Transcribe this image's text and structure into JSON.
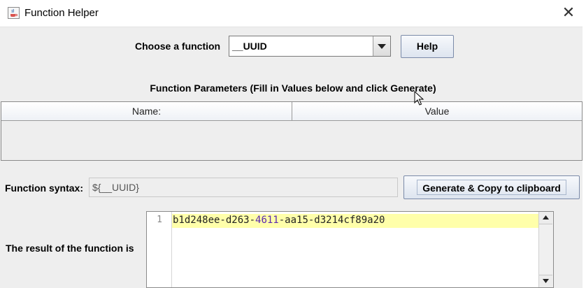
{
  "window": {
    "title": "Function Helper",
    "close_symbol": "✕"
  },
  "chooser": {
    "label": "Choose a function",
    "selected": "__UUID",
    "help_label": "Help"
  },
  "parameters": {
    "title": "Function Parameters (Fill in Values below and click Generate)",
    "columns": [
      "Name:",
      "Value"
    ],
    "rows": []
  },
  "syntax": {
    "label": "Function syntax:",
    "value": "${__UUID}",
    "generate_label": "Generate & Copy to clipboard"
  },
  "result": {
    "label": "The result of the function is",
    "line_numbers": [
      "1"
    ],
    "value_parts": [
      "b1d248ee-d263-",
      "4611",
      "-aa15-d3214cf89a20"
    ]
  },
  "icons": {
    "app": "java-coffee-icon",
    "close": "close-icon",
    "dropdown": "chevron-down-icon",
    "cursor": "mouse-pointer-icon"
  },
  "colors": {
    "highlight_line": "#ffffaa",
    "number_token": "#5a2ab0",
    "background": "#eeeeee"
  }
}
